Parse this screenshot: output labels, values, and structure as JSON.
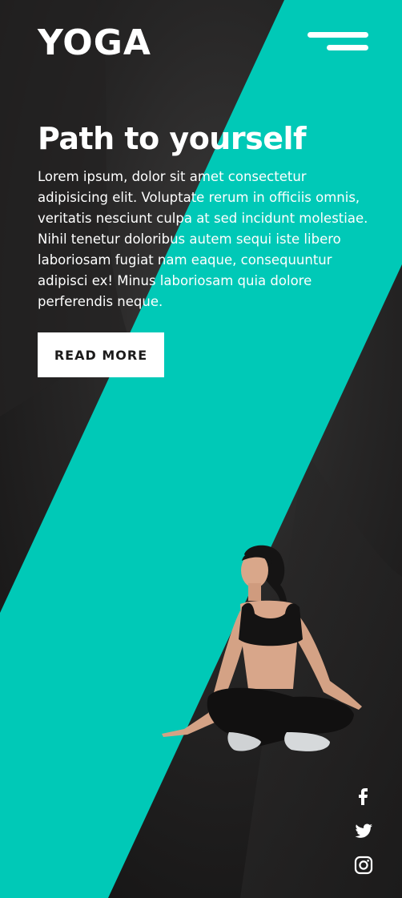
{
  "brand": {
    "logo": "YOGA",
    "accent_color": "#00c9b7",
    "background_color": "#1c1b1b"
  },
  "header": {
    "menu_icon": "hamburger-menu-icon"
  },
  "hero": {
    "title": "Path to yourself",
    "text": "Lorem ipsum, dolor sit amet consectetur adipisicing elit. Voluptate rerum in officiis omnis, veritatis nesciunt culpa at sed incidunt molestiae. Nihil tenetur doloribus autem sequi iste libero laboriosam fugiat nam eaque, consequuntur adipisci ex! Minus laboriosam quia dolore perferendis neque.",
    "button_label": "READ MORE"
  },
  "social": {
    "icons": [
      "facebook-icon",
      "twitter-icon",
      "instagram-icon"
    ]
  }
}
